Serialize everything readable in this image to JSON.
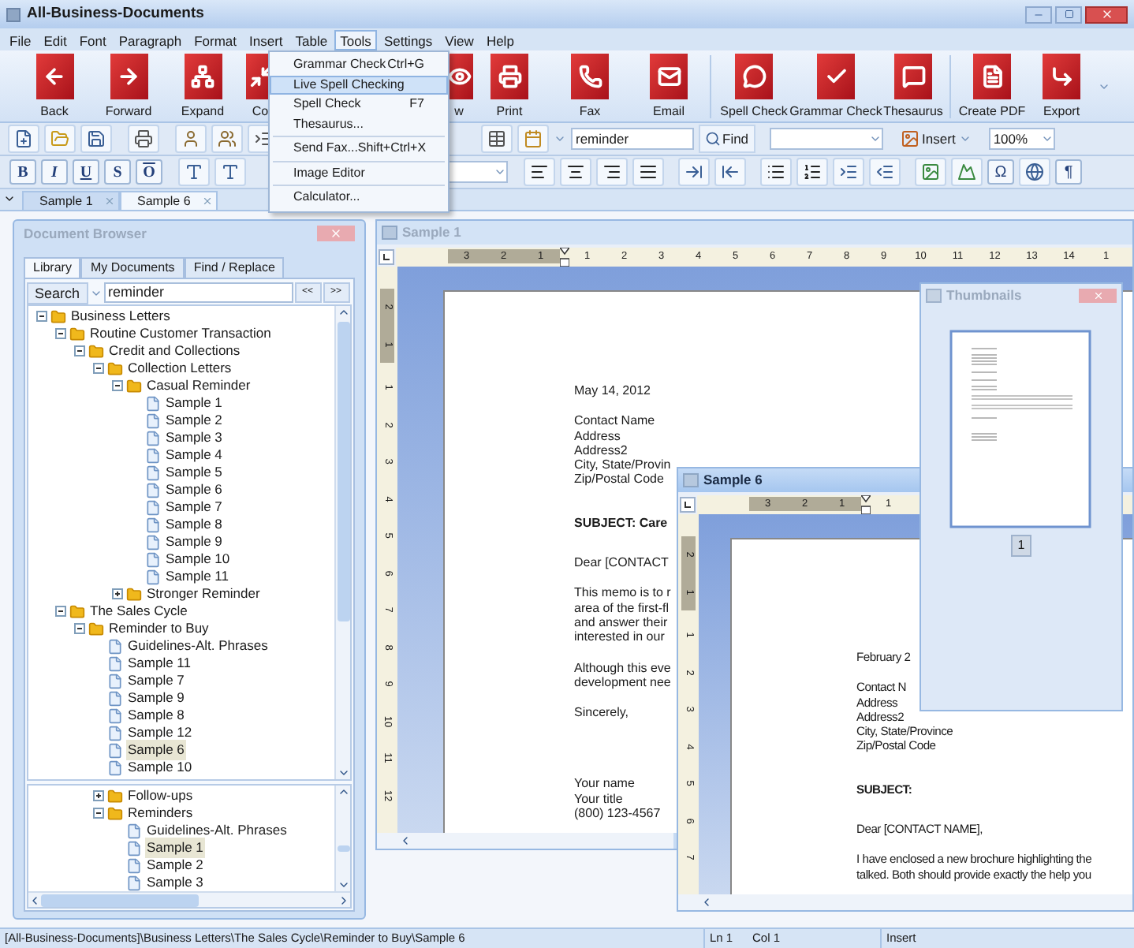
{
  "window": {
    "title": "All-Business-Documents"
  },
  "menu_bar": [
    {
      "label": "File",
      "selected": false
    },
    {
      "label": "Edit",
      "selected": false
    },
    {
      "label": "Font",
      "selected": false
    },
    {
      "label": "Paragraph",
      "selected": false
    },
    {
      "label": "Format",
      "selected": false
    },
    {
      "label": "Insert",
      "selected": false
    },
    {
      "label": "Table",
      "selected": false
    },
    {
      "label": "Tools",
      "selected": true
    },
    {
      "label": "Settings",
      "selected": false
    },
    {
      "label": "View",
      "selected": false
    },
    {
      "label": "Help",
      "selected": false
    }
  ],
  "tools_menu": [
    {
      "kind": "item",
      "label": "Grammar Check",
      "shortcut": "Ctrl+G",
      "selected": false
    },
    {
      "kind": "item",
      "label": "Live Spell Checking",
      "selected": true
    },
    {
      "kind": "item",
      "label": "Spell Check",
      "shortcut": "F7",
      "selected": false
    },
    {
      "kind": "item",
      "label": "Thesaurus...",
      "selected": false
    },
    {
      "kind": "separator"
    },
    {
      "kind": "item",
      "label": "Send Fax...",
      "shortcut": "Shift+Ctrl+X",
      "selected": false
    },
    {
      "kind": "separator"
    },
    {
      "kind": "item",
      "label": "Image Editor",
      "selected": false
    },
    {
      "kind": "separator"
    },
    {
      "kind": "item",
      "label": "Calculator...",
      "selected": false
    }
  ],
  "main_toolbar": [
    {
      "kind": "button",
      "label": "Back"
    },
    {
      "kind": "button",
      "label": "Forward"
    },
    {
      "kind": "button",
      "label": "Expand"
    },
    {
      "kind": "clipped",
      "label": "Co"
    },
    {
      "kind": "clipped",
      "label": "w"
    },
    {
      "kind": "button",
      "label": "Print"
    },
    {
      "kind": "button",
      "label": "Fax"
    },
    {
      "kind": "button",
      "label": "Email"
    },
    {
      "kind": "separator"
    },
    {
      "kind": "button",
      "label": "Spell Check"
    },
    {
      "kind": "button",
      "label": "Grammar Check"
    },
    {
      "kind": "button",
      "label": "Thesaurus"
    },
    {
      "kind": "separator"
    },
    {
      "kind": "button",
      "label": "Create PDF"
    },
    {
      "kind": "button",
      "label": "Export"
    }
  ],
  "search_toolbar": {
    "search_value": "reminder",
    "find_button": "Find",
    "insert_button": "Insert",
    "zoom_value": "100%"
  },
  "format_toolbar": {
    "text_buttons": [
      "B",
      "I",
      "U",
      "S",
      "O"
    ],
    "symbol_buttons": [
      "Ω",
      "¶"
    ]
  },
  "document_tabs": [
    {
      "label": "Sample 1",
      "selected": false
    },
    {
      "label": "Sample 6",
      "selected": true
    }
  ],
  "document_browser": {
    "title": "Document Browser",
    "tabs": [
      {
        "label": "Library",
        "selected": true
      },
      {
        "label": "My Documents",
        "selected": false
      },
      {
        "label": "Find / Replace",
        "selected": false
      }
    ],
    "search_button": "Search",
    "search_value": "reminder",
    "prev_button": "<<",
    "next_button": ">>",
    "tree": [
      {
        "kind": "folder",
        "label": "Business Letters",
        "expanded": true,
        "selected": false,
        "children": [
          {
            "kind": "folder",
            "label": "Routine Customer Transaction",
            "expanded": true,
            "selected": false,
            "children": [
              {
                "kind": "folder",
                "label": "Credit and Collections",
                "expanded": true,
                "selected": false,
                "children": [
                  {
                    "kind": "folder",
                    "label": "Collection Letters",
                    "expanded": true,
                    "selected": false,
                    "children": [
                      {
                        "kind": "folder",
                        "label": "Casual Reminder",
                        "expanded": true,
                        "selected": false,
                        "children": [
                          {
                            "kind": "document",
                            "label": "Sample 1",
                            "selected": false
                          },
                          {
                            "kind": "document",
                            "label": "Sample 2",
                            "selected": false
                          },
                          {
                            "kind": "document",
                            "label": "Sample 3",
                            "selected": false
                          },
                          {
                            "kind": "document",
                            "label": "Sample 4",
                            "selected": false
                          },
                          {
                            "kind": "document",
                            "label": "Sample 5",
                            "selected": false
                          },
                          {
                            "kind": "document",
                            "label": "Sample 6",
                            "selected": false
                          },
                          {
                            "kind": "document",
                            "label": "Sample 7",
                            "selected": false
                          },
                          {
                            "kind": "document",
                            "label": "Sample 8",
                            "selected": false
                          },
                          {
                            "kind": "document",
                            "label": "Sample 9",
                            "selected": false
                          },
                          {
                            "kind": "document",
                            "label": "Sample 10",
                            "selected": false
                          },
                          {
                            "kind": "document",
                            "label": "Sample 11",
                            "selected": false
                          }
                        ]
                      },
                      {
                        "kind": "folder",
                        "label": "Stronger Reminder",
                        "expanded": false,
                        "selected": false
                      }
                    ]
                  }
                ]
              }
            ]
          },
          {
            "kind": "folder",
            "label": "The Sales Cycle",
            "expanded": true,
            "selected": false,
            "children": [
              {
                "kind": "folder",
                "label": "Reminder to Buy",
                "expanded": true,
                "selected": false,
                "children": [
                  {
                    "kind": "document",
                    "label": "Guidelines-Alt. Phrases",
                    "selected": false
                  },
                  {
                    "kind": "document",
                    "label": "Sample 11",
                    "selected": false
                  },
                  {
                    "kind": "document",
                    "label": "Sample 7",
                    "selected": false
                  },
                  {
                    "kind": "document",
                    "label": "Sample 9",
                    "selected": false
                  },
                  {
                    "kind": "document",
                    "label": "Sample 8",
                    "selected": false
                  },
                  {
                    "kind": "document",
                    "label": "Sample 12",
                    "selected": false
                  },
                  {
                    "kind": "document",
                    "label": "Sample 6",
                    "selected": true
                  },
                  {
                    "kind": "document",
                    "label": "Sample 10",
                    "selected": false
                  }
                ]
              }
            ]
          }
        ]
      }
    ],
    "lower_tree": [
      {
        "kind": "folder",
        "label": "Follow-ups",
        "expanded": false,
        "selected": false
      },
      {
        "kind": "folder",
        "label": "Reminders",
        "expanded": true,
        "selected": false,
        "children": [
          {
            "kind": "document",
            "label": "Guidelines-Alt. Phrases",
            "selected": false
          },
          {
            "kind": "document",
            "label": "Sample 1",
            "selected": true
          },
          {
            "kind": "document",
            "label": "Sample 2",
            "selected": false
          },
          {
            "kind": "document",
            "label": "Sample 3",
            "selected": false
          }
        ]
      }
    ]
  },
  "documents": [
    {
      "title": "Sample 1",
      "active": false,
      "ruler": {
        "left_labels": [
          "3",
          "2",
          "1"
        ],
        "right_labels": [
          "1",
          "2",
          "3",
          "4",
          "5",
          "6",
          "7",
          "8",
          "9",
          "10",
          "11",
          "12",
          "13",
          "14",
          "1"
        ]
      },
      "vertical_ruler": {
        "top_labels": [
          "2",
          "1"
        ],
        "bottom_labels": [
          "1",
          "2",
          "3",
          "4",
          "5",
          "6",
          "7",
          "8",
          "9",
          "10",
          "11",
          "12"
        ]
      },
      "paragraphs": [
        {
          "kind": "text",
          "lines": [
            "May 14, 2012"
          ]
        },
        {
          "kind": "text",
          "lines": [
            "Contact Name",
            "Address",
            "Address2",
            "City, State/Provin",
            "Zip/Postal Code"
          ]
        },
        {
          "kind": "heading",
          "lines": [
            "SUBJECT: Care"
          ]
        },
        {
          "kind": "text",
          "lines": [
            "Dear [CONTACT"
          ]
        },
        {
          "kind": "text",
          "lines": [
            "This memo is to r",
            "area of the first-fl",
            "and answer their",
            "interested in our"
          ]
        },
        {
          "kind": "text",
          "lines": [
            "Although this eve",
            "development nee"
          ]
        },
        {
          "kind": "text",
          "lines": [
            "Sincerely,"
          ]
        },
        {
          "kind": "signature",
          "lines": [
            "Your name",
            "Your title",
            "(800) 123-4567"
          ]
        }
      ]
    },
    {
      "title": "Sample 6",
      "active": true,
      "ruler": {
        "left_labels": [
          "3",
          "2",
          "1"
        ],
        "right_labels": [
          "1"
        ]
      },
      "vertical_ruler": {
        "top_labels": [
          "2",
          "1"
        ],
        "bottom_labels": [
          "1",
          "2",
          "3",
          "4",
          "5",
          "6",
          "7"
        ]
      },
      "paragraphs": [
        {
          "kind": "text",
          "lines": [
            "February 2"
          ]
        },
        {
          "kind": "text",
          "lines": [
            "Contact N",
            "Address",
            "Address2",
            "City, State/Province",
            "Zip/Postal Code"
          ]
        },
        {
          "kind": "heading",
          "lines": [
            "SUBJECT:"
          ]
        },
        {
          "kind": "text",
          "lines": [
            "Dear [CONTACT NAME],"
          ]
        },
        {
          "kind": "text",
          "lines": [
            "I have enclosed a new brochure highlighting the",
            "talked. Both should provide exactly the help you"
          ]
        }
      ]
    }
  ],
  "thumbnails": {
    "title": "Thumbnails",
    "page_number": "1"
  },
  "status_bar": {
    "path": "[All-Business-Documents]\\Business Letters\\The Sales Cycle\\Reminder to Buy\\Sample 6",
    "line": "Ln 1",
    "column": "Col 1",
    "mode": "Insert"
  }
}
